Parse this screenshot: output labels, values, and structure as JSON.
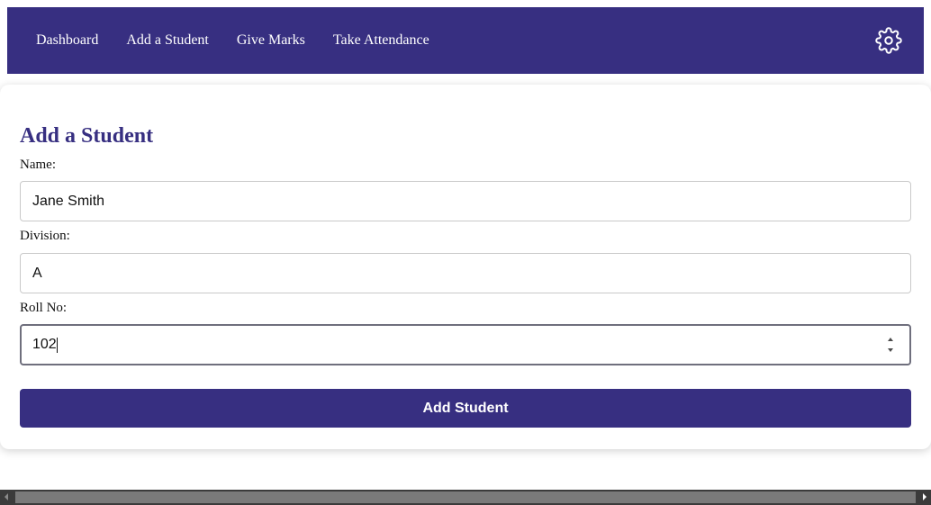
{
  "nav": {
    "links": [
      "Dashboard",
      "Add a Student",
      "Give Marks",
      "Take Attendance"
    ],
    "settings_icon": "gear-icon"
  },
  "form": {
    "title": "Add a Student",
    "name_label": "Name:",
    "name_value": "Jane Smith",
    "division_label": "Division:",
    "division_value": "A",
    "roll_label": "Roll No:",
    "roll_value": "102",
    "submit_label": "Add Student"
  },
  "colors": {
    "primary": "#372f81",
    "white": "#ffffff"
  }
}
